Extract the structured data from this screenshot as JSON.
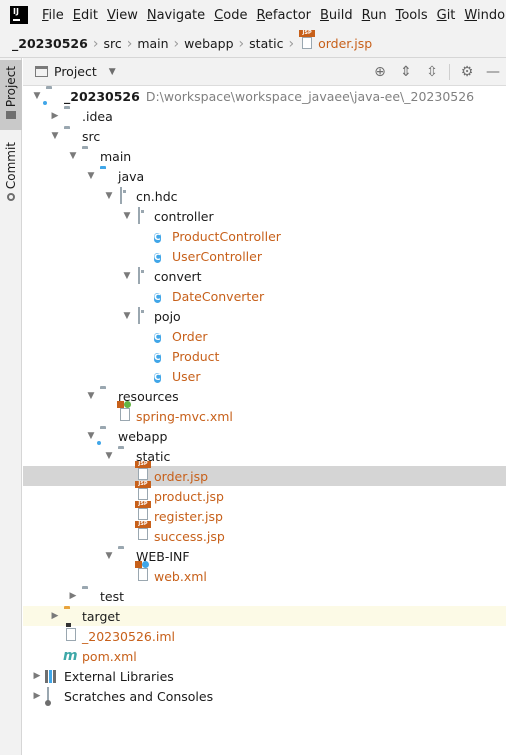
{
  "menu": [
    "File",
    "Edit",
    "View",
    "Navigate",
    "Code",
    "Refactor",
    "Build",
    "Run",
    "Tools",
    "Git",
    "Windo"
  ],
  "app_logo_text": "IJ",
  "breadcrumb": [
    "_20230526",
    "src",
    "main",
    "webapp",
    "static",
    "order.jsp"
  ],
  "side_tabs": {
    "project": "Project",
    "commit": "Commit"
  },
  "panel": {
    "title": "Project"
  },
  "tree": [
    {
      "label": "_20230526",
      "path": "D:\\workspace\\workspace_javaee\\java-ee\\_20230526"
    },
    {
      "label": ".idea"
    },
    {
      "label": "src"
    },
    {
      "label": "main"
    },
    {
      "label": "java"
    },
    {
      "label": "cn.hdc"
    },
    {
      "label": "controller"
    },
    {
      "label": "ProductController"
    },
    {
      "label": "UserController"
    },
    {
      "label": "convert"
    },
    {
      "label": "DateConverter"
    },
    {
      "label": "pojo"
    },
    {
      "label": "Order"
    },
    {
      "label": "Product"
    },
    {
      "label": "User"
    },
    {
      "label": "resources"
    },
    {
      "label": "spring-mvc.xml"
    },
    {
      "label": "webapp"
    },
    {
      "label": "static"
    },
    {
      "label": "order.jsp"
    },
    {
      "label": "product.jsp"
    },
    {
      "label": "register.jsp"
    },
    {
      "label": "success.jsp"
    },
    {
      "label": "WEB-INF"
    },
    {
      "label": "web.xml"
    },
    {
      "label": "test"
    },
    {
      "label": "target"
    },
    {
      "label": "_20230526.iml"
    },
    {
      "label": "pom.xml"
    },
    {
      "label": "External Libraries"
    },
    {
      "label": "Scratches and Consoles"
    }
  ],
  "colors": {
    "vcs_new": "#c7601a",
    "folder_blue": "#40a6e8",
    "folder_excluded": "#e8a33d",
    "selection": "#d5d5d5"
  },
  "icons": {
    "class": "C",
    "jsp": "JSP",
    "maven": "m"
  }
}
